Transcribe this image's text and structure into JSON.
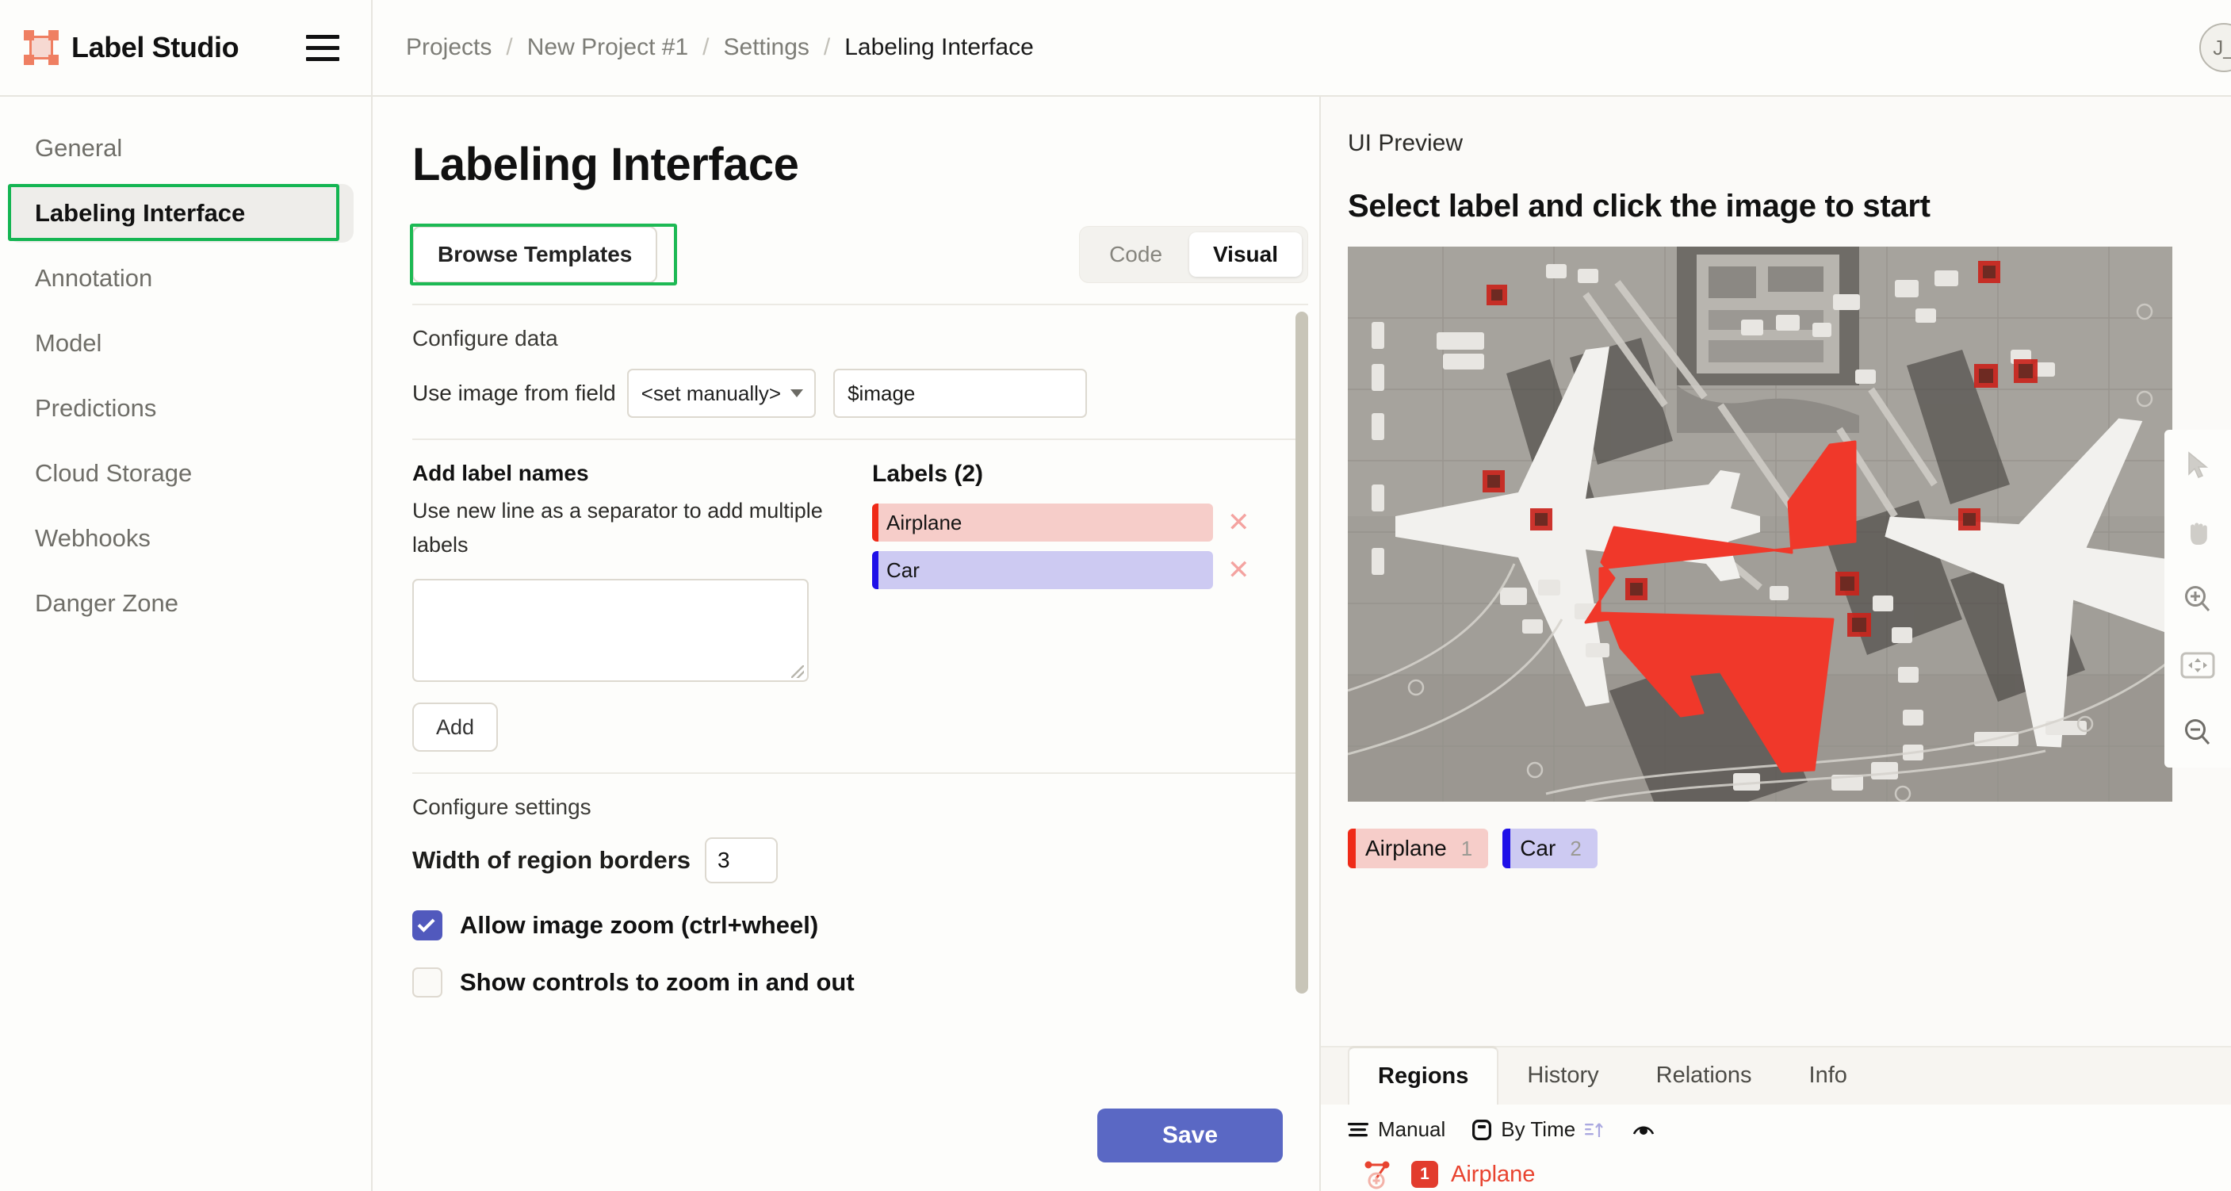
{
  "brand": {
    "name": "Label Studio",
    "logo_color": "#ef7f62"
  },
  "header": {
    "menu_icon": "hamburger-icon",
    "breadcrumbs": [
      {
        "label": "Projects",
        "current": false
      },
      {
        "label": "New Project #1",
        "current": false
      },
      {
        "label": "Settings",
        "current": false
      },
      {
        "label": "Labeling Interface",
        "current": true
      }
    ],
    "separator": "/",
    "avatar_initials": "J_"
  },
  "sidebar": {
    "items": [
      {
        "label": "General",
        "active": false
      },
      {
        "label": "Labeling Interface",
        "active": true
      },
      {
        "label": "Annotation",
        "active": false
      },
      {
        "label": "Model",
        "active": false
      },
      {
        "label": "Predictions",
        "active": false
      },
      {
        "label": "Cloud Storage",
        "active": false
      },
      {
        "label": "Webhooks",
        "active": false
      },
      {
        "label": "Danger Zone",
        "active": false
      }
    ]
  },
  "main": {
    "title": "Labeling Interface",
    "browse_templates_label": "Browse Templates",
    "view_toggle": {
      "options": [
        "Code",
        "Visual"
      ],
      "selected": "Visual"
    },
    "configure_data": {
      "section_title": "Configure data",
      "field_label": "Use image from field",
      "select_value": "<set manually>",
      "input_value": "$image"
    },
    "add_labels": {
      "title": "Add label names",
      "hint": "Use new line as a separator to add multiple labels",
      "textarea_value": "",
      "textarea_placeholder": "",
      "add_button_label": "Add"
    },
    "labels_panel": {
      "title": "Labels (2)",
      "remove_glyph": "✕",
      "items": [
        {
          "name": "Airplane",
          "bg": "#f6cdc9",
          "bar": "#ef2a18"
        },
        {
          "name": "Car",
          "bg": "#cdcaf2",
          "bar": "#1f10e8"
        }
      ]
    },
    "configure_settings": {
      "section_title": "Configure settings",
      "border_width_label": "Width of region borders",
      "border_width_value": "3",
      "checkboxes": [
        {
          "label": "Allow image zoom (ctrl+wheel)",
          "checked": true
        },
        {
          "label": "Show controls to zoom in and out",
          "checked": false
        }
      ]
    },
    "save_label": "Save",
    "save_color": "#5a68c4"
  },
  "preview": {
    "kicker": "UI Preview",
    "heading": "Select label and click the image to start",
    "image_alt": "aerial-airport-photo-with-red-airplane-region",
    "label_chips": [
      {
        "name": "Airplane",
        "hotkey": "1",
        "bg": "#f6cdc9",
        "bar": "#ef2a18"
      },
      {
        "name": "Car",
        "hotkey": "2",
        "bg": "#cdcaf2",
        "bar": "#1f10e8"
      }
    ],
    "tabs": [
      {
        "label": "Regions",
        "active": true
      },
      {
        "label": "History",
        "active": false
      },
      {
        "label": "Relations",
        "active": false
      },
      {
        "label": "Info",
        "active": false
      }
    ],
    "sort_controls": [
      {
        "label": "Manual",
        "icon": "sort-lines-icon"
      },
      {
        "label": "By Time",
        "icon": "clock-box-icon"
      }
    ],
    "visibility_icon": "eye-icon",
    "regions": [
      {
        "index": "1",
        "name": "Airplane",
        "color": "#e8432f",
        "icon": "polygon-icon"
      }
    ],
    "toolbar_icons": [
      "cursor-icon",
      "hand-pan-icon",
      "zoom-in-icon",
      "fit-to-screen-icon",
      "zoom-out-icon"
    ]
  }
}
